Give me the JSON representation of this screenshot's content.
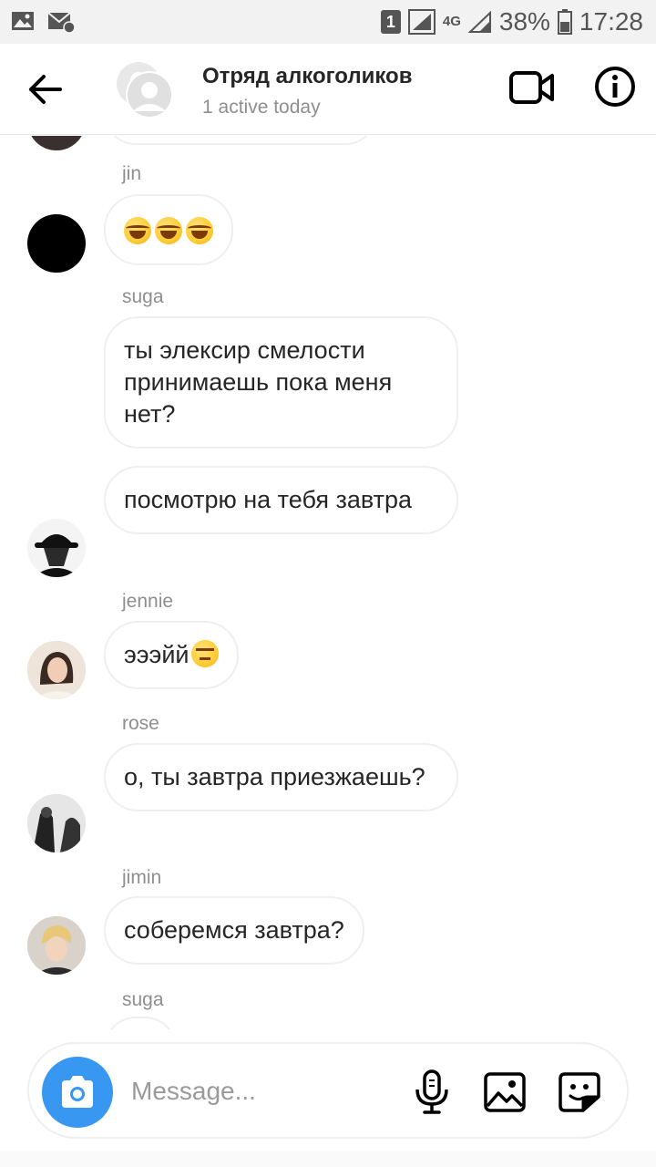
{
  "status_bar": {
    "sim": "1",
    "network": "4G",
    "battery": "38%",
    "time": "17:28"
  },
  "header": {
    "title": "Отряд алкоголиков",
    "subtitle": "1 active today"
  },
  "messages": [
    {
      "sender": "jin",
      "text": ""
    },
    {
      "sender": "suga",
      "text": "ты элексир смелости принимаешь пока меня нет?"
    },
    {
      "sender": "",
      "text": "посмотрю на тебя завтра"
    },
    {
      "sender": "jennie",
      "text": "эээйй"
    },
    {
      "sender": "rose",
      "text": "о, ты завтра приезжаешь?"
    },
    {
      "sender": "jimin",
      "text": "соберемся завтра?"
    },
    {
      "sender": "suga",
      "text": ""
    }
  ],
  "composer": {
    "placeholder": "Message..."
  },
  "icons": {
    "back": "arrow-left-icon",
    "video": "video-camera-icon",
    "info": "info-icon",
    "camera": "camera-icon",
    "mic": "microphone-icon",
    "gallery": "image-icon",
    "sticker": "sticker-icon"
  },
  "colors": {
    "accent": "#3897f0",
    "bubble_border": "#efefef",
    "secondary_text": "#8e8e8e"
  }
}
